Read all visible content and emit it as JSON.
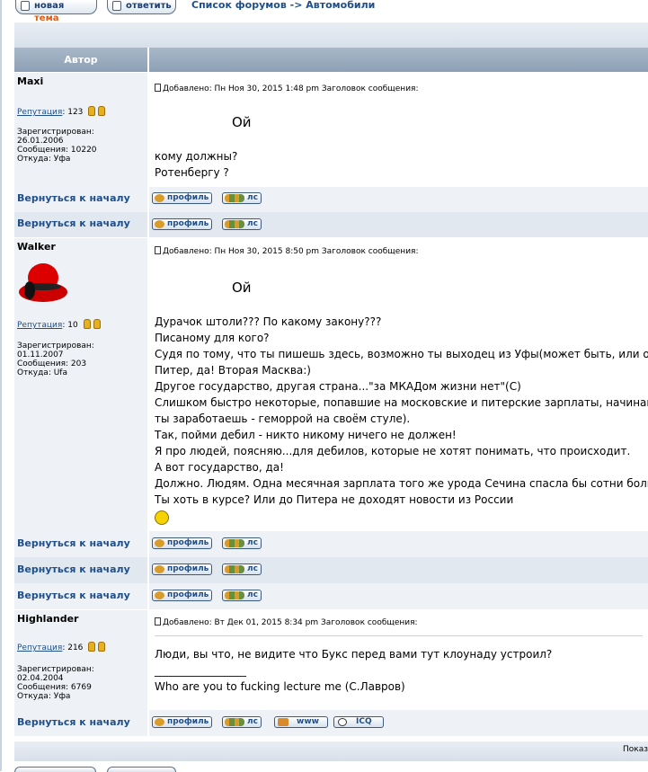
{
  "toolbar": {
    "new_topic_a": "новая",
    "new_topic_b": "тема",
    "reply": "ответить"
  },
  "breadcrumb": {
    "forums": "Список форумов",
    "sep": "->",
    "section": "Автомобили"
  },
  "table_header": {
    "author": "Автор"
  },
  "labels": {
    "reputation": "Репутация",
    "back_to_top": "Вернуться к началу",
    "profile": "профиль",
    "pm": "лс",
    "www": "www",
    "icq": "ICQ"
  },
  "footer": {
    "text": "Показ"
  },
  "posts": [
    {
      "author": "Maxi",
      "reputation": "123",
      "registered_label": "Зарегистрирован:",
      "registered": "26.01.2006",
      "messages": "Сообщения: 10220",
      "from": "Откуда: Уфа",
      "header": "Добавлено: Пн Ноя 30, 2015 1:48 pm    Заголовок сообщения:",
      "title": "Ой",
      "lines": [
        "кому должны?",
        "Ротенбергу ?"
      ]
    },
    {
      "author": "Walker",
      "reputation": "10",
      "registered_label": "Зарегистрирован:",
      "registered": "01.11.2007",
      "messages": "Сообщения: 203",
      "from": "Откуда: Ufa",
      "header": "Добавлено: Пн Ноя 30, 2015 8:50 pm    Заголовок сообщения:",
      "title": "Ой",
      "lines": [
        "Дурачок штоли??? По какому закону???",
        "Писаному для кого?",
        "Судя по тому, что ты пишешь здесь, возможно ты выходец из Уфы(может быть, или обы",
        "Питер, да! Вторая Масква:)",
        "Другое государство, другая страна...\"за МКАДом жизни нет\"(С)",
        "Слишком быстро некоторые, попавшие на московские и питерские зарплаты, начинают",
        "ты заработаешь - геморрой на своём стуле).",
        "Так, пойми дебил - никто никому ничего не должен!",
        "Я про людей, поясняю...для дебилов, которые не хотят понимать, что происходит.",
        "А вот государство, да!",
        "Должно. Людям. Одна месячная зарплата того же урода Сечина спасла бы сотни больны:",
        "Ты хоть в курсе? Или до Питера не доходят новости из России"
      ]
    },
    {
      "author": "Highlander",
      "reputation": "216",
      "registered_label": "Зарегистрирован:",
      "registered": "02.04.2004",
      "messages": "Сообщения: 6769",
      "from": "Откуда: Уфа",
      "header": "Добавлено: Вт Дек 01, 2015 8:34 pm    Заголовок сообщения:",
      "lines": [
        "Люди, вы что, не видите что Букс перед вами тут клоунаду устроил?",
        "_________________",
        "Who are you to fucking lecture me (С.Лавров)"
      ]
    }
  ]
}
